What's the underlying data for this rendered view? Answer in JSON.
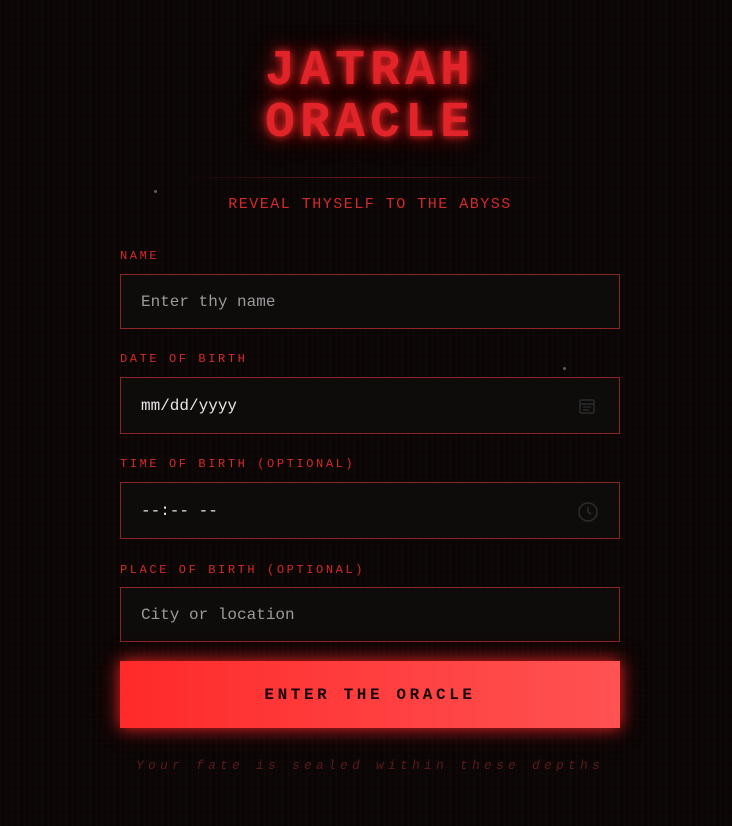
{
  "header": {
    "title_line1": "JATRAH",
    "title_line2": "ORACLE",
    "subtitle": "REVEAL THYSELF TO THE ABYSS"
  },
  "form": {
    "name": {
      "label": "NAME",
      "placeholder": "Enter thy name"
    },
    "dob": {
      "label": "DATE OF BIRTH",
      "value": "mm/dd/yyyy",
      "icon": "calendar-icon"
    },
    "tob": {
      "label": "TIME OF BIRTH (OPTIONAL)",
      "value": "--:-- --",
      "icon": "clock-icon"
    },
    "pob": {
      "label": "PLACE OF BIRTH (OPTIONAL)",
      "placeholder": "City or location"
    },
    "submit_label": "ENTER THE ORACLE"
  },
  "footer": {
    "text": "Your fate is sealed within these depths"
  },
  "colors": {
    "background": "#0a0606",
    "accent": "#e0242a",
    "field_border": "#8c2424",
    "button": "#ff3a3a"
  }
}
